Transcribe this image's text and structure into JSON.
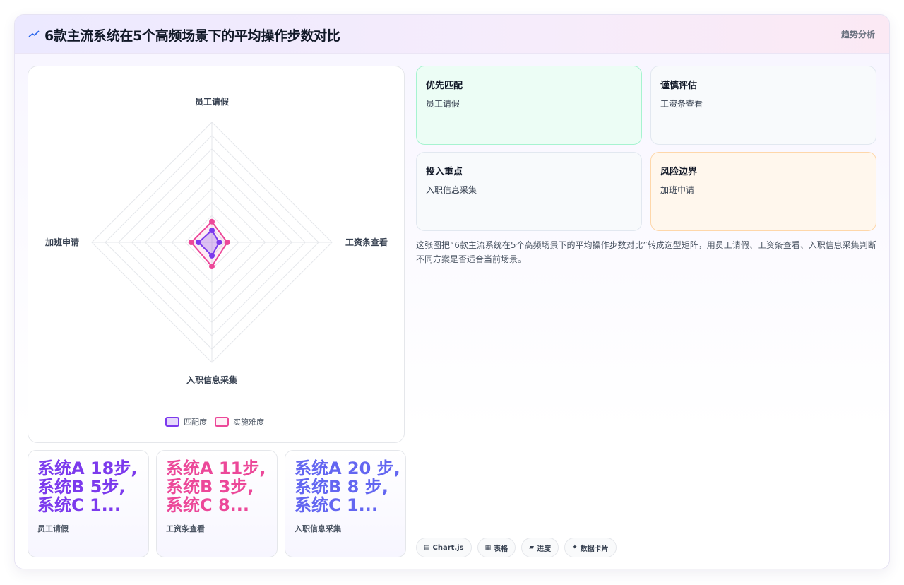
{
  "header": {
    "title": "6款主流系统在5个高频场景下的平均操作步数对比",
    "tag": "趋势分析"
  },
  "chart_data": {
    "type": "radar",
    "axes": [
      "员工请假",
      "工资条查看",
      "入职信息采集",
      "加班申请"
    ],
    "series": [
      {
        "name": "匹配度",
        "values": [
          18,
          11,
          20,
          20
        ],
        "color": "#7c3aed"
      },
      {
        "name": "实施难度",
        "values": [
          31,
          23,
          36,
          31
        ],
        "color": "#ec4899"
      }
    ],
    "rlim": [
      0,
      180
    ],
    "grid_rings": 9
  },
  "stats": [
    {
      "value": "系统A 18步, 系统B 5步, 系统C 1...",
      "label": "员工请假",
      "color": "#7c3aed"
    },
    {
      "value": "系统A 11步, 系统B 3步, 系统C 8...",
      "label": "工资条查看",
      "color": "#ec4899"
    },
    {
      "value": "系统A 20 步, 系统B 8 步, 系统C 1...",
      "label": "入职信息采集",
      "color": "#6366f1"
    }
  ],
  "cards": [
    {
      "title": "优先匹配",
      "value": "员工请假",
      "bg": "#ecfdf5",
      "border": "#a7f3d0"
    },
    {
      "title": "谨慎评估",
      "value": "工资条查看",
      "bg": "#f8fafc",
      "border": "#e2e8f0"
    },
    {
      "title": "投入重点",
      "value": "入职信息采集",
      "bg": "#f8fafc",
      "border": "#e2e8f0"
    },
    {
      "title": "风险边界",
      "value": "加班申请",
      "bg": "#fff7ed",
      "border": "#fed7aa"
    }
  ],
  "description": "这张图把“6款主流系统在5个高频场景下的平均操作步数对比”转成选型矩阵，用员工请假、工资条查看、入职信息采集判断不同方案是否适合当前场景。",
  "chips": [
    {
      "icon": "chart-icon",
      "glyph": "▤",
      "label": "Chart.js"
    },
    {
      "icon": "table-icon",
      "glyph": "▦",
      "label": "表格"
    },
    {
      "icon": "progress-icon",
      "glyph": "▰",
      "label": "进度"
    },
    {
      "icon": "card-icon",
      "glyph": "✦",
      "label": "数据卡片"
    }
  ]
}
